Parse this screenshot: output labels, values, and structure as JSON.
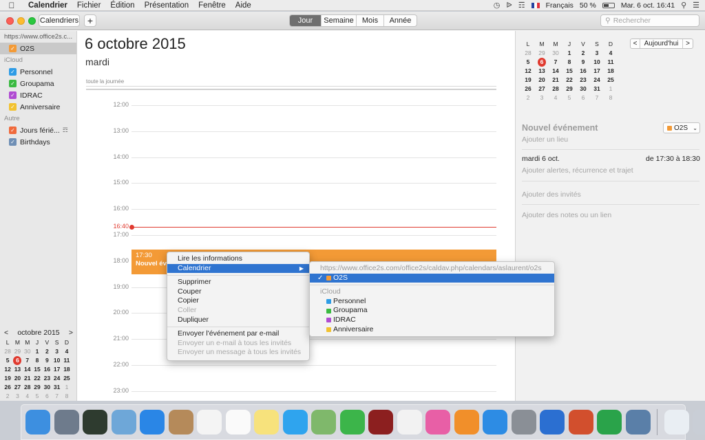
{
  "menubar": {
    "app": "Calendrier",
    "items": [
      "Fichier",
      "Édition",
      "Présentation",
      "Fenêtre",
      "Aide"
    ],
    "language": "Français",
    "battery": "50 %",
    "datetime": "Mar. 6 oct.  16:41"
  },
  "toolbar": {
    "calendars_label": "Calendriers",
    "add_label": "+",
    "views": [
      "Jour",
      "Semaine",
      "Mois",
      "Année"
    ],
    "active_view": "Jour",
    "search_placeholder": "Rechercher"
  },
  "sidebar": {
    "account_url": "https://www.office2s.c...",
    "account_calendar": {
      "label": "O2S",
      "color": "#f39a36"
    },
    "icloud_label": "iCloud",
    "icloud_calendars": [
      {
        "label": "Personnel",
        "color": "#2e9ce6"
      },
      {
        "label": "Groupama",
        "color": "#3bba42"
      },
      {
        "label": "IDRAC",
        "color": "#b04bd2"
      },
      {
        "label": "Anniversaire",
        "color": "#f2c230"
      }
    ],
    "other_label": "Autre",
    "other_calendars": [
      {
        "label": "Jours férié...",
        "color": "#f06a3c"
      },
      {
        "label": "Birthdays",
        "color": "#6f8fb5"
      }
    ],
    "mini_calendar": {
      "month": "octobre 2015",
      "prev": "<",
      "next": ">"
    }
  },
  "weekdays": [
    "L",
    "M",
    "M",
    "J",
    "V",
    "S",
    "D"
  ],
  "month_grid": [
    [
      "28",
      "29",
      "30",
      "1",
      "2",
      "3",
      "4"
    ],
    [
      "5",
      "6",
      "7",
      "8",
      "9",
      "10",
      "11"
    ],
    [
      "12",
      "13",
      "14",
      "15",
      "16",
      "17",
      "18"
    ],
    [
      "19",
      "20",
      "21",
      "22",
      "23",
      "24",
      "25"
    ],
    [
      "26",
      "27",
      "28",
      "29",
      "30",
      "31",
      "1"
    ],
    [
      "2",
      "3",
      "4",
      "5",
      "6",
      "7",
      "8"
    ]
  ],
  "day_view": {
    "title": "6 octobre 2015",
    "weekday": "mardi",
    "allday_label": "toute la journée",
    "hours": [
      "12:00",
      "13:00",
      "14:00",
      "15:00",
      "16:00",
      "17:00",
      "18:00",
      "19:00",
      "20:00",
      "21:00",
      "22:00",
      "23:00"
    ],
    "now_label": "16:40",
    "event": {
      "time": "17:30",
      "title": "Nouvel événement",
      "color": "#f39a36"
    }
  },
  "inspector": {
    "today_button": "Aujourd'hui",
    "prev": "<",
    "next": ">",
    "title": "Nouvel événement",
    "calendar": "O2S",
    "add_location": "Ajouter un lieu",
    "date": "mardi 6 oct.",
    "time_range": "de 17:30 à 18:30",
    "alerts": "Ajouter alertes, récurrence et trajet",
    "invitees": "Ajouter des invités",
    "notes": "Ajouter des notes ou un lien"
  },
  "context_menu": {
    "items": [
      {
        "label": "Lire les informations",
        "state": "normal"
      },
      {
        "label": "Calendrier",
        "state": "highlighted",
        "submenu": true
      },
      {
        "sep": true
      },
      {
        "label": "Supprimer",
        "state": "normal"
      },
      {
        "label": "Couper",
        "state": "normal"
      },
      {
        "label": "Copier",
        "state": "normal"
      },
      {
        "label": "Coller",
        "state": "disabled"
      },
      {
        "label": "Dupliquer",
        "state": "normal"
      },
      {
        "sep": true
      },
      {
        "label": "Envoyer l'événement par e-mail",
        "state": "normal"
      },
      {
        "label": "Envoyer un e-mail à tous les invités",
        "state": "disabled"
      },
      {
        "label": "Envoyer un message à tous les invités",
        "state": "disabled"
      }
    ]
  },
  "submenu": {
    "account_url": "https://www.office2s.com/office2s/caldav.php/calendars/aslaurent/o2s",
    "selected": {
      "label": "O2S",
      "color": "#f39a36",
      "check": "✓"
    },
    "icloud_label": "iCloud",
    "calendars": [
      {
        "label": "Personnel",
        "color": "#2e9ce6"
      },
      {
        "label": "Groupama",
        "color": "#3bba42"
      },
      {
        "label": "IDRAC",
        "color": "#b04bd2"
      },
      {
        "label": "Anniversaire",
        "color": "#f2c230"
      }
    ]
  },
  "dock": {
    "apps": [
      {
        "name": "finder-icon",
        "color": "#3d8fe0"
      },
      {
        "name": "launchpad-icon",
        "color": "#6e7b8c"
      },
      {
        "name": "mission-control-icon",
        "color": "#2e3b2f"
      },
      {
        "name": "preview-icon",
        "color": "#6ea7d8"
      },
      {
        "name": "safari-icon",
        "color": "#2a86e6"
      },
      {
        "name": "contacts-icon",
        "color": "#b58a5a"
      },
      {
        "name": "calendar-icon",
        "color": "#f4f4f4"
      },
      {
        "name": "reminders-icon",
        "color": "#fafafa"
      },
      {
        "name": "notes-icon",
        "color": "#f7e27c"
      },
      {
        "name": "messages-icon",
        "color": "#2fa4ee"
      },
      {
        "name": "maps-icon",
        "color": "#7fb86b"
      },
      {
        "name": "facetime-icon",
        "color": "#3cb54a"
      },
      {
        "name": "photo-booth-icon",
        "color": "#8c1f1f"
      },
      {
        "name": "photos-icon",
        "color": "#f2f2f2"
      },
      {
        "name": "itunes-icon",
        "color": "#e85fa6"
      },
      {
        "name": "ibooks-icon",
        "color": "#f18f2a"
      },
      {
        "name": "app-store-icon",
        "color": "#2d8ce4"
      },
      {
        "name": "system-preferences-icon",
        "color": "#8a8f96"
      },
      {
        "name": "word-icon",
        "color": "#2b6fd1"
      },
      {
        "name": "powerpoint-icon",
        "color": "#d24f2d"
      },
      {
        "name": "excel-icon",
        "color": "#2aa34a"
      },
      {
        "name": "image-capture-icon",
        "color": "#5a7fa8"
      }
    ],
    "extras": [
      {
        "name": "downloads-stack-icon",
        "color": "#e9eef3"
      },
      {
        "name": "trash-icon",
        "color": "#c9ced6"
      }
    ]
  }
}
